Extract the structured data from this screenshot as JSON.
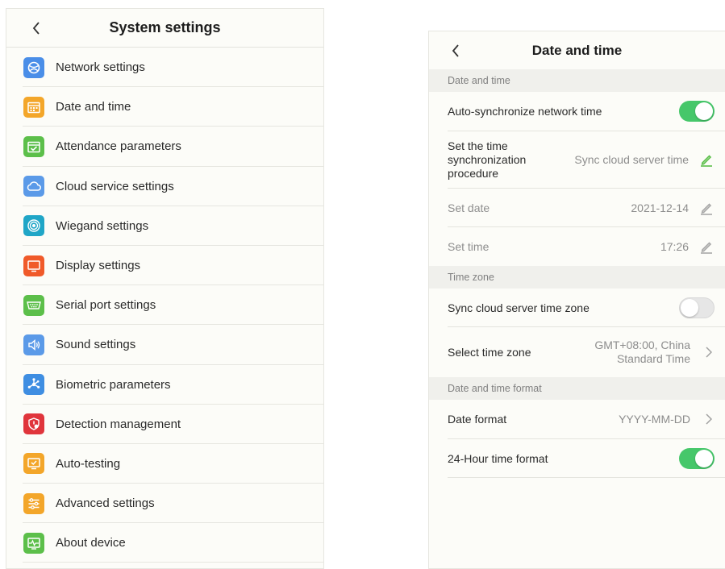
{
  "system": {
    "title": "System settings",
    "items": [
      {
        "label": "Network settings",
        "icon": "network-icon",
        "color": "#4a8ee8"
      },
      {
        "label": "Date and time",
        "icon": "calendar-icon",
        "color": "#f3a62a"
      },
      {
        "label": "Attendance parameters",
        "icon": "calendar-check-icon",
        "color": "#5cbf4a"
      },
      {
        "label": "Cloud service settings",
        "icon": "cloud-icon",
        "color": "#5b9ae8"
      },
      {
        "label": "Wiegand settings",
        "icon": "wiegand-icon",
        "color": "#20a6c7"
      },
      {
        "label": "Display settings",
        "icon": "monitor-icon",
        "color": "#f05a2a"
      },
      {
        "label": "Serial port settings",
        "icon": "serial-port-icon",
        "color": "#5cbf4a"
      },
      {
        "label": "Sound settings",
        "icon": "speaker-icon",
        "color": "#5b9ae8"
      },
      {
        "label": "Biometric parameters",
        "icon": "biometric-icon",
        "color": "#3f8ee2"
      },
      {
        "label": "Detection management",
        "icon": "shield-icon",
        "color": "#e0353c"
      },
      {
        "label": "Auto-testing",
        "icon": "auto-test-icon",
        "color": "#f3a62a"
      },
      {
        "label": "Advanced settings",
        "icon": "sliders-icon",
        "color": "#f3a62a"
      },
      {
        "label": "About device",
        "icon": "device-info-icon",
        "color": "#5cbf4a"
      }
    ]
  },
  "datetime": {
    "title": "Date and time",
    "section1": "Date and time",
    "auto_sync_label": "Auto-synchronize network time",
    "auto_sync_on": true,
    "sync_proc_label": "Set the time synchronization procedure",
    "sync_proc_value": "Sync cloud server time",
    "set_date_label": "Set date",
    "set_date_value": "2021-12-14",
    "set_time_label": "Set time",
    "set_time_value": "17:26",
    "section2": "Time zone",
    "sync_tz_label": "Sync cloud server time zone",
    "sync_tz_on": false,
    "select_tz_label": "Select time zone",
    "select_tz_value": "GMT+08:00, China Standard Time",
    "section3": "Date and time format",
    "date_format_label": "Date format",
    "date_format_value": "YYYY-MM-DD",
    "hour24_label": "24-Hour time format",
    "hour24_on": true,
    "accent": "#46c76a"
  }
}
